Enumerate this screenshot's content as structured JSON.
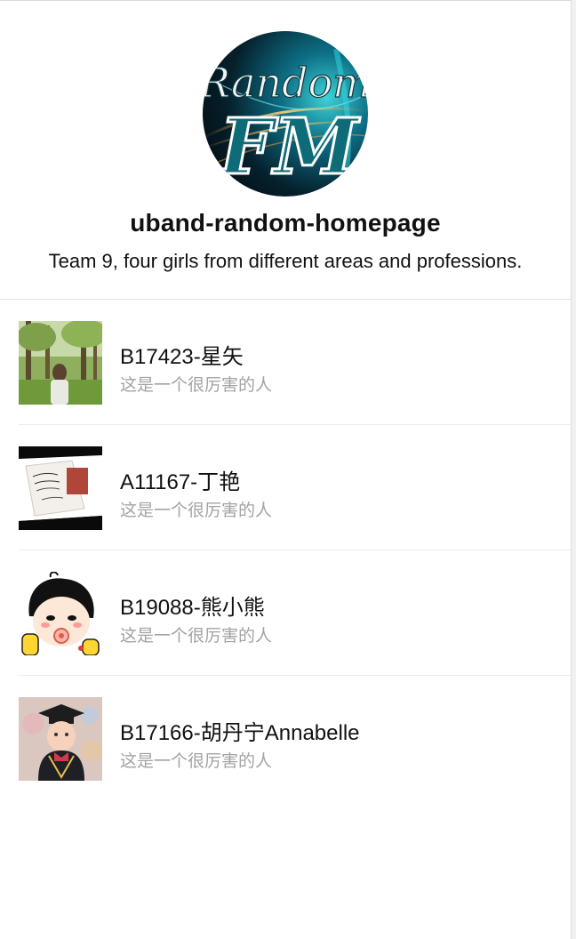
{
  "header": {
    "logo_text_top": "Random",
    "logo_text_bottom": "FM",
    "title": "uband-random-homepage",
    "subtitle": "Team 9, four girls from different areas and professions."
  },
  "members": [
    {
      "name": "B17423-星矢",
      "desc": "这是一个很厉害的人",
      "avatar": "forest-photo"
    },
    {
      "name": "A11167-丁艳",
      "desc": "这是一个很厉害的人",
      "avatar": "card-photo"
    },
    {
      "name": "B19088-熊小熊",
      "desc": "这是一个很厉害的人",
      "avatar": "cartoon-baby"
    },
    {
      "name": "B17166-胡丹宁Annabelle",
      "desc": "这是一个很厉害的人",
      "avatar": "graduation-baby-photo"
    }
  ]
}
